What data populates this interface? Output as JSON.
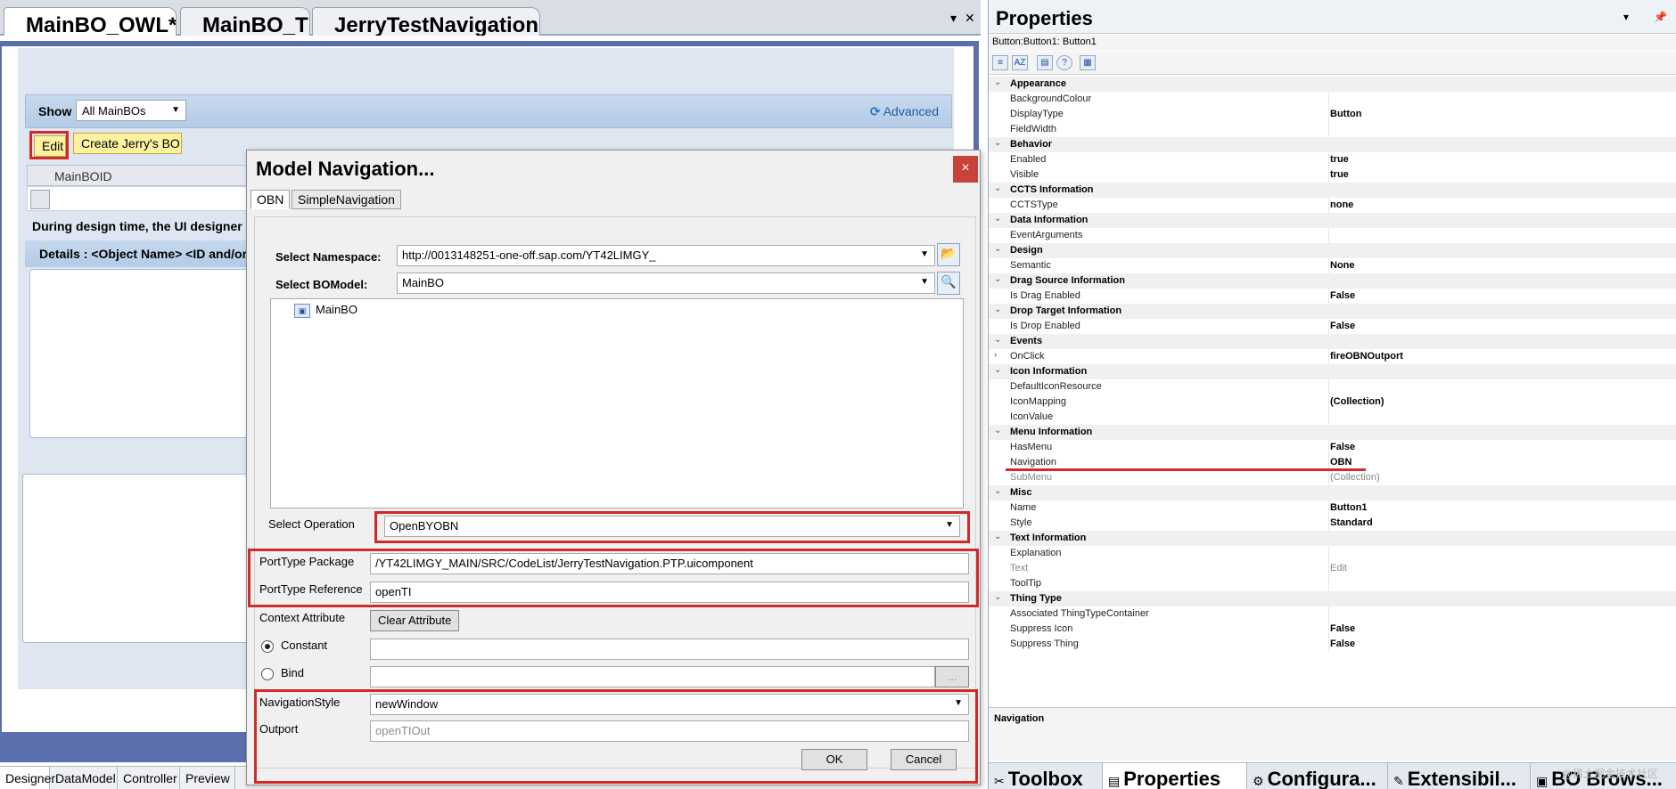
{
  "doc_tabs": [
    {
      "label": "MainBO_OWL*"
    },
    {
      "label": "MainBO_TI"
    },
    {
      "label": "JerryTestNavigation"
    }
  ],
  "designer": {
    "show_label": "Show",
    "show_value": "All MainBOs",
    "advanced_label": "Advanced",
    "edit_button": "Edit",
    "create_button": "Create Jerry's BO",
    "grid_header": "MainBOID",
    "info_text": "During design time, the UI designer d",
    "details_text": "Details : <Object Name> <ID and/or"
  },
  "bottom_tabs": [
    {
      "label": "Designer"
    },
    {
      "label": "DataModel"
    },
    {
      "label": "Controller"
    },
    {
      "label": "Preview"
    }
  ],
  "dialog": {
    "title": "Model Navigation...",
    "close_glyph": "×",
    "tabs": [
      {
        "label": "OBN"
      },
      {
        "label": "SimpleNavigation"
      }
    ],
    "namespace_label": "Select Namespace:",
    "namespace_value": "http://0013148251-one-off.sap.com/YT42LIMGY_",
    "bomodel_label": "Select BOModel:",
    "bomodel_value": "MainBO",
    "tree_item": "MainBO",
    "operation_label": "Select Operation",
    "operation_value": "OpenBYOBN",
    "porttype_package_label": "PortType Package",
    "porttype_package_value": "/YT42LIMGY_MAIN/SRC/CodeList/JerryTestNavigation.PTP.uicomponent",
    "porttype_reference_label": "PortType Reference",
    "porttype_reference_value": "openTI",
    "context_attribute_label": "Context Attribute",
    "clear_attribute_button": "Clear Attribute",
    "constant_label": "Constant",
    "constant_value": "",
    "bind_label": "Bind",
    "bind_value": "",
    "ellipsis": "...",
    "navigation_style_label": "NavigationStyle",
    "navigation_style_value": "newWindow",
    "outport_label": "Outport",
    "outport_value": "openTIOut",
    "ok_button": "OK",
    "cancel_button": "Cancel"
  },
  "properties": {
    "title": "Properties",
    "object": "Button:Button1: Button1",
    "rows": [
      {
        "type": "cat",
        "name": "Appearance"
      },
      {
        "type": "prop",
        "name": "BackgroundColour",
        "value": ""
      },
      {
        "type": "prop",
        "name": "DisplayType",
        "value": "Button"
      },
      {
        "type": "prop",
        "name": "FieldWidth",
        "value": ""
      },
      {
        "type": "cat",
        "name": "Behavior"
      },
      {
        "type": "prop",
        "name": "Enabled",
        "value": "true"
      },
      {
        "type": "prop",
        "name": "Visible",
        "value": "true"
      },
      {
        "type": "cat",
        "name": "CCTS Information"
      },
      {
        "type": "prop",
        "name": "CCTSType",
        "value": "none"
      },
      {
        "type": "cat",
        "name": "Data Information"
      },
      {
        "type": "prop",
        "name": "EventArguments",
        "value": ""
      },
      {
        "type": "cat",
        "name": "Design"
      },
      {
        "type": "prop",
        "name": "Semantic",
        "value": "None"
      },
      {
        "type": "cat",
        "name": "Drag Source Information"
      },
      {
        "type": "prop",
        "name": "Is Drag Enabled",
        "value": "False"
      },
      {
        "type": "cat",
        "name": "Drop Target Information"
      },
      {
        "type": "prop",
        "name": "Is Drop Enabled",
        "value": "False"
      },
      {
        "type": "cat",
        "name": "Events"
      },
      {
        "type": "prop",
        "name": "OnClick",
        "value": "fireOBNOutport",
        "expand": true
      },
      {
        "type": "cat",
        "name": "Icon Information"
      },
      {
        "type": "prop",
        "name": "DefaultIconResource",
        "value": ""
      },
      {
        "type": "prop",
        "name": "IconMapping",
        "value": "(Collection)"
      },
      {
        "type": "prop",
        "name": "IconValue",
        "value": ""
      },
      {
        "type": "cat",
        "name": "Menu Information"
      },
      {
        "type": "prop",
        "name": "HasMenu",
        "value": "False"
      },
      {
        "type": "prop",
        "name": "Navigation",
        "value": "OBN"
      },
      {
        "type": "prop",
        "name": "SubMenu",
        "value": "(Collection)",
        "dim": true
      },
      {
        "type": "cat",
        "name": "Misc"
      },
      {
        "type": "prop",
        "name": "Name",
        "value": "Button1"
      },
      {
        "type": "prop",
        "name": "Style",
        "value": "Standard"
      },
      {
        "type": "cat",
        "name": "Text Information"
      },
      {
        "type": "prop",
        "name": "Explanation",
        "value": ""
      },
      {
        "type": "prop",
        "name": "Text",
        "value": "Edit",
        "dim": true
      },
      {
        "type": "prop",
        "name": "ToolTip",
        "value": ""
      },
      {
        "type": "cat",
        "name": "Thing Type"
      },
      {
        "type": "prop",
        "name": "Associated ThingTypeContainer",
        "value": ""
      },
      {
        "type": "prop",
        "name": "Suppress Icon",
        "value": "False"
      },
      {
        "type": "prop",
        "name": "Suppress Thing",
        "value": "False"
      }
    ],
    "description_title": "Navigation",
    "bottom_tabs": [
      {
        "label": "Toolbox"
      },
      {
        "label": "Properties"
      },
      {
        "label": "Configura..."
      },
      {
        "label": "Extensibil..."
      },
      {
        "label": "BO Brows..."
      }
    ],
    "watermark": "@稀土掘金技术社区"
  },
  "colors": {
    "highlight_red": "#d22a2a",
    "link_blue": "#1c5ea8",
    "button_yellow": "#fdf2a0",
    "frame_blue": "#5b6fae"
  }
}
